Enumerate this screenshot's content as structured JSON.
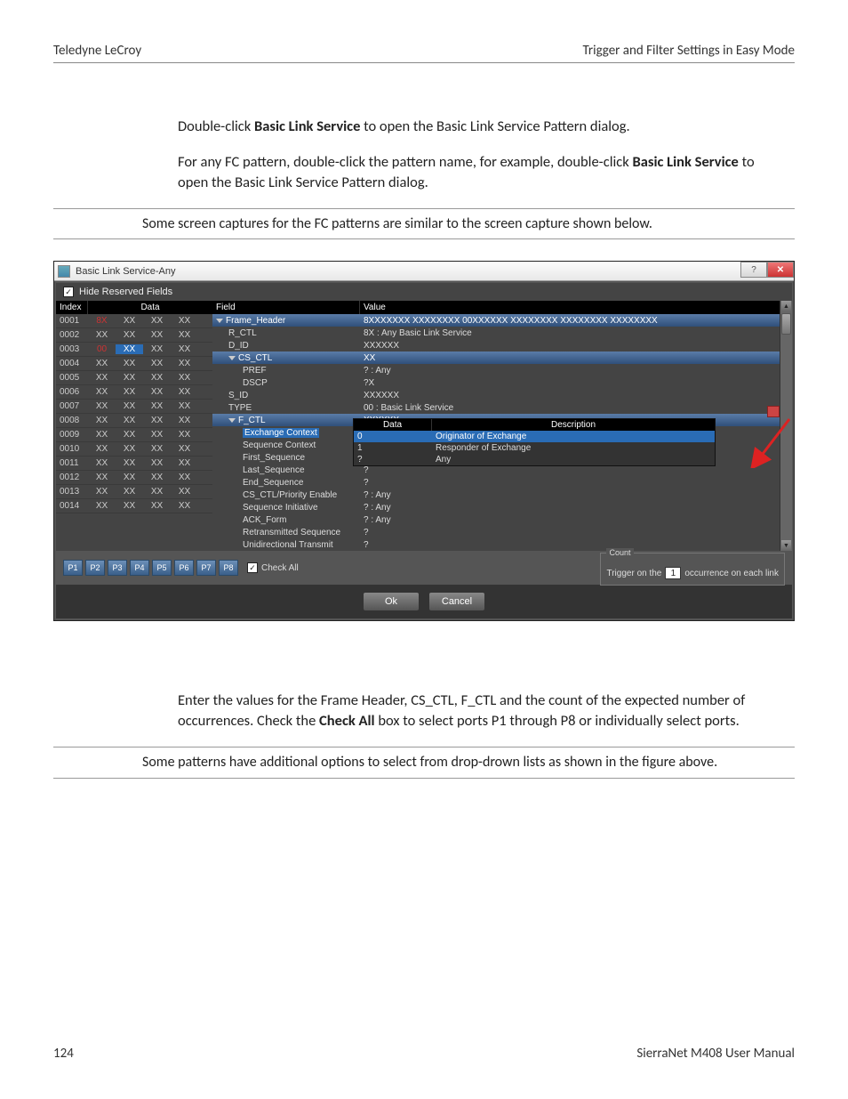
{
  "page": {
    "header_left": "Teledyne LeCroy",
    "header_right": "Trigger and Filter Settings in Easy Mode",
    "intro1_pre": "Double-click ",
    "intro1_bold": "Basic Link Service",
    "intro1_post": " to open the Basic Link Service Pattern dialog.",
    "intro2_pre": "For any FC pattern, double-click the pattern name, for example, double-click ",
    "intro2_bold": "Basic Link Service",
    "intro2_post": " to open the Basic Link Service Pattern dialog.",
    "note1": "Some screen captures for the FC patterns are similar to the screen capture shown below.",
    "after1_pre": "Enter the values for the Frame Header, CS_CTL, F_CTL and the count of the expected number of occurrences. Check the ",
    "after1_bold": "Check All",
    "after1_post": " box to select ports P1 through P8 or individually select ports.",
    "note2": "Some patterns have additional options to select from drop-drown lists as shown in the figure above.",
    "footer_left": "124",
    "footer_right": "SierraNet M408 User Manual"
  },
  "dialog": {
    "title": "Basic Link Service-Any",
    "hide_reserved": "Hide Reserved Fields",
    "index_hdr": "Index",
    "data_hdr": "Data",
    "field_hdr": "Field",
    "value_hdr": "Value",
    "check_all": "Check All",
    "count_label": "Count",
    "trigger_pre": "Trigger on the",
    "trigger_num": "1",
    "trigger_post": "occurrence on each link",
    "ok": "Ok",
    "cancel": "Cancel",
    "ports": [
      "P1",
      "P2",
      "P3",
      "P4",
      "P5",
      "P6",
      "P7",
      "P8"
    ],
    "data_rows": [
      {
        "idx": "0001",
        "d": [
          "8X",
          "XX",
          "XX",
          "XX"
        ]
      },
      {
        "idx": "0002",
        "d": [
          "XX",
          "XX",
          "XX",
          "XX"
        ]
      },
      {
        "idx": "0003",
        "d": [
          "00",
          "XX",
          "XX",
          "XX"
        ]
      },
      {
        "idx": "0004",
        "d": [
          "XX",
          "XX",
          "XX",
          "XX"
        ]
      },
      {
        "idx": "0005",
        "d": [
          "XX",
          "XX",
          "XX",
          "XX"
        ]
      },
      {
        "idx": "0006",
        "d": [
          "XX",
          "XX",
          "XX",
          "XX"
        ]
      },
      {
        "idx": "0007",
        "d": [
          "XX",
          "XX",
          "XX",
          "XX"
        ]
      },
      {
        "idx": "0008",
        "d": [
          "XX",
          "XX",
          "XX",
          "XX"
        ]
      },
      {
        "idx": "0009",
        "d": [
          "XX",
          "XX",
          "XX",
          "XX"
        ]
      },
      {
        "idx": "0010",
        "d": [
          "XX",
          "XX",
          "XX",
          "XX"
        ]
      },
      {
        "idx": "0011",
        "d": [
          "XX",
          "XX",
          "XX",
          "XX"
        ]
      },
      {
        "idx": "0012",
        "d": [
          "XX",
          "XX",
          "XX",
          "XX"
        ]
      },
      {
        "idx": "0013",
        "d": [
          "XX",
          "XX",
          "XX",
          "XX"
        ]
      },
      {
        "idx": "0014",
        "d": [
          "XX",
          "XX",
          "XX",
          "XX"
        ]
      }
    ],
    "fields": [
      {
        "f": "Frame_Header",
        "v": "8XXXXXXX XXXXXXXX 00XXXXXX XXXXXXXX XXXXXXXX XXXXXXXX",
        "cls": "hdr",
        "ind": 0,
        "tri": 1
      },
      {
        "f": "R_CTL",
        "v": "8X : Any Basic Link Service",
        "ind": 1
      },
      {
        "f": "D_ID",
        "v": "XXXXXX",
        "ind": 1
      },
      {
        "f": "CS_CTL",
        "v": "XX",
        "cls": "hdr",
        "ind": 1,
        "tri": 1
      },
      {
        "f": "PREF",
        "v": "? : Any",
        "ind": 2
      },
      {
        "f": "DSCP",
        "v": "?X",
        "ind": 2
      },
      {
        "f": "S_ID",
        "v": "XXXXXX",
        "ind": 1
      },
      {
        "f": "TYPE",
        "v": "00 : Basic Link Service",
        "ind": 1
      },
      {
        "f": "F_CTL",
        "v": "XXXXXX",
        "cls": "hdr",
        "ind": 1,
        "tri": 1
      },
      {
        "f": "Exchange Context",
        "v": "?",
        "cls": "selblue",
        "ind": 2
      },
      {
        "f": "Sequence Context",
        "v": "?",
        "ind": 2
      },
      {
        "f": "First_Sequence",
        "v": "?",
        "ind": 2
      },
      {
        "f": "Last_Sequence",
        "v": "?",
        "ind": 2
      },
      {
        "f": "End_Sequence",
        "v": "?",
        "ind": 2
      },
      {
        "f": "CS_CTL/Priority Enable",
        "v": "? : Any",
        "ind": 2
      },
      {
        "f": "Sequence Initiative",
        "v": "? : Any",
        "ind": 2
      },
      {
        "f": "ACK_Form",
        "v": "? : Any",
        "ind": 2
      },
      {
        "f": "Retransmitted Sequence",
        "v": "?",
        "ind": 2
      },
      {
        "f": "Unidirectional Transmit",
        "v": "?",
        "ind": 2
      }
    ],
    "dropdown": {
      "h1": "Data",
      "h2": "Description",
      "rows": [
        {
          "d": "0",
          "desc": "Originator of Exchange",
          "sel": true
        },
        {
          "d": "1",
          "desc": "Responder of Exchange"
        },
        {
          "d": "?",
          "desc": "Any"
        }
      ]
    }
  }
}
